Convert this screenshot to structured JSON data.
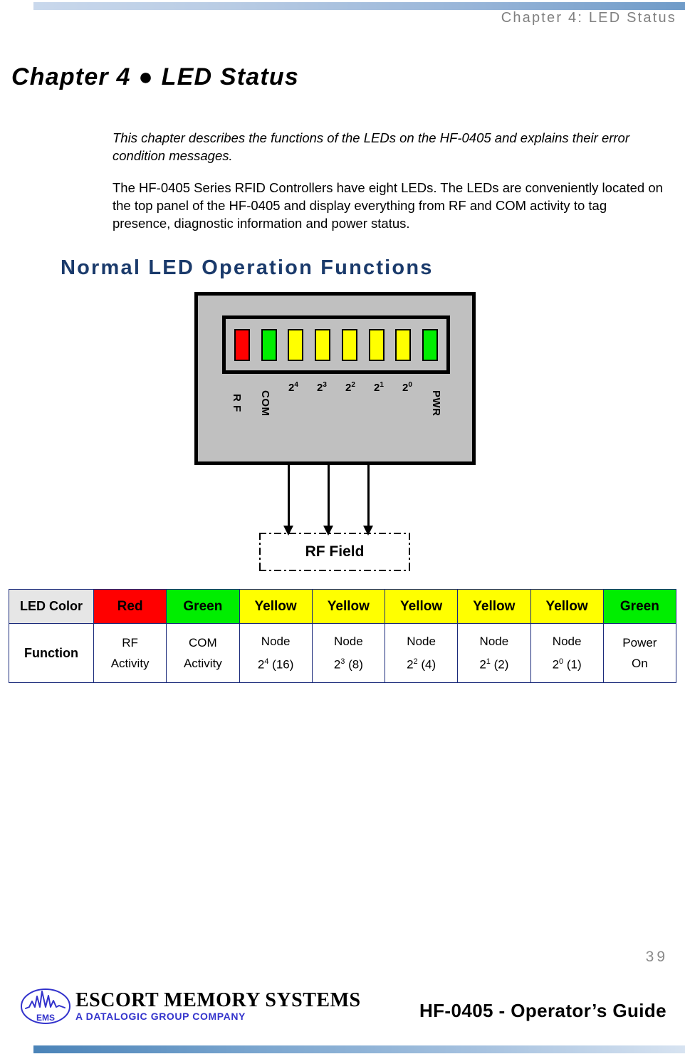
{
  "header": {
    "running_head": "Chapter 4: LED Status",
    "rule_gradient_from": "#c9d8ec",
    "rule_gradient_to": "#6f9bc8"
  },
  "chapter": {
    "title": "Chapter 4 ● LED Status"
  },
  "paragraphs": {
    "intro": "This chapter describes the functions of the LEDs on the HF-0405 and explains their error condition messages.",
    "body1": "The HF-0405 Series RFID Controllers have eight LEDs. The LEDs are conveniently located on the top panel of the HF-0405 and display everything from RF and COM activity to tag presence, diagnostic information and power status."
  },
  "section": {
    "heading": "Normal LED Operation Functions",
    "heading_color": "#1a3a6b"
  },
  "diagram": {
    "panel_bg": "#c0c0c0",
    "leds": [
      {
        "label": "R F",
        "rotated": true,
        "color": "#ff0000",
        "name": "rf"
      },
      {
        "label": "COM",
        "rotated": true,
        "color": "#00ee00",
        "name": "com"
      },
      {
        "label": "2",
        "exp": "4",
        "rotated": false,
        "color": "#ffff00",
        "name": "node-16"
      },
      {
        "label": "2",
        "exp": "3",
        "rotated": false,
        "color": "#ffff00",
        "name": "node-8"
      },
      {
        "label": "2",
        "exp": "2",
        "rotated": false,
        "color": "#ffff00",
        "name": "node-4"
      },
      {
        "label": "2",
        "exp": "1",
        "rotated": false,
        "color": "#ffff00",
        "name": "node-2"
      },
      {
        "label": "2",
        "exp": "0",
        "rotated": false,
        "color": "#ffff00",
        "name": "node-1"
      },
      {
        "label": "PWR",
        "rotated": true,
        "color": "#00ee00",
        "name": "pwr"
      }
    ],
    "callout_label": "RF Field",
    "arrow_count": 3
  },
  "table": {
    "row_labels": [
      "LED Color",
      "Function"
    ],
    "colors": [
      {
        "name": "Red",
        "hex": "#ff0000"
      },
      {
        "name": "Green",
        "hex": "#00ee00"
      },
      {
        "name": "Yellow",
        "hex": "#ffff00"
      },
      {
        "name": "Yellow",
        "hex": "#ffff00"
      },
      {
        "name": "Yellow",
        "hex": "#ffff00"
      },
      {
        "name": "Yellow",
        "hex": "#ffff00"
      },
      {
        "name": "Yellow",
        "hex": "#ffff00"
      },
      {
        "name": "Green",
        "hex": "#00ee00"
      }
    ],
    "functions": [
      {
        "line1": "RF",
        "line2": "Activity",
        "base": "",
        "exp": "",
        "suffix": ""
      },
      {
        "line1": "COM",
        "line2": "Activity",
        "base": "",
        "exp": "",
        "suffix": ""
      },
      {
        "line1": "Node",
        "line2": "",
        "base": "2",
        "exp": "4",
        "suffix": " (16)"
      },
      {
        "line1": "Node",
        "line2": "",
        "base": "2",
        "exp": "3",
        "suffix": " (8)"
      },
      {
        "line1": "Node",
        "line2": "",
        "base": "2",
        "exp": "2",
        "suffix": " (4)"
      },
      {
        "line1": "Node",
        "line2": "",
        "base": "2",
        "exp": "1",
        "suffix": " (2)"
      },
      {
        "line1": "Node",
        "line2": "",
        "base": "2",
        "exp": "0",
        "suffix": " (1)"
      },
      {
        "line1": "Power",
        "line2": "On",
        "base": "",
        "exp": "",
        "suffix": ""
      }
    ],
    "border_color": "#1a2a7a",
    "row_label_bg": "#e6e6e6"
  },
  "footer": {
    "page_number": "39",
    "logo_title": "ESCORT MEMORY SYSTEMS",
    "logo_subtitle": "A DATALOGIC GROUP COMPANY",
    "logo_badge": "EMS",
    "logo_color": "#3333cc",
    "guide": "HF-0405 - Operator’s Guide",
    "rule_gradient_from": "#4a83b8",
    "rule_gradient_to": "#d7e3f1"
  }
}
